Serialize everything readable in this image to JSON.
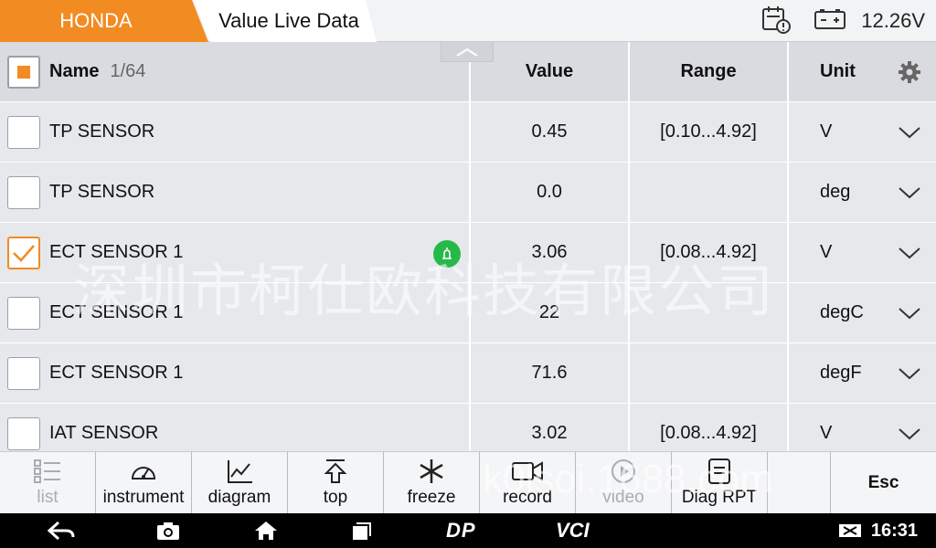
{
  "header": {
    "make_tab": "HONDA",
    "screen_tab": "Value Live Data",
    "voltage": "12.26V"
  },
  "columns": {
    "name": "Name",
    "count": "1/64",
    "value": "Value",
    "range": "Range",
    "unit": "Unit"
  },
  "rows": [
    {
      "name": "TP SENSOR",
      "value": "0.45",
      "range": "[0.10...4.92]",
      "unit": "V",
      "checked": false,
      "alert": false
    },
    {
      "name": "TP SENSOR",
      "value": "0.0",
      "range": "",
      "unit": "deg",
      "checked": false,
      "alert": false
    },
    {
      "name": "ECT SENSOR 1",
      "value": "3.06",
      "range": "[0.08...4.92]",
      "unit": "V",
      "checked": true,
      "alert": true
    },
    {
      "name": "ECT SENSOR 1",
      "value": "22",
      "range": "",
      "unit": "degC",
      "checked": false,
      "alert": false
    },
    {
      "name": "ECT SENSOR 1",
      "value": "71.6",
      "range": "",
      "unit": "degF",
      "checked": false,
      "alert": false
    },
    {
      "name": "IAT SENSOR",
      "value": "3.02",
      "range": "[0.08...4.92]",
      "unit": "V",
      "checked": false,
      "alert": false
    }
  ],
  "toolbar": {
    "list": "list",
    "instrument": "instrument",
    "diagram": "diagram",
    "top": "top",
    "freeze": "freeze",
    "record": "record",
    "video": "video",
    "diag_rpt": "Diag RPT",
    "esc": "Esc"
  },
  "navbar": {
    "dp": "DP",
    "vci": "VCI",
    "clock": "16:31"
  },
  "watermark": {
    "cn": "深圳市柯仕欧科技有限公司",
    "url": "k0lsoi.1688.com"
  },
  "colors": {
    "accent": "#f28b22",
    "alert": "#27b84a",
    "row_bg": "#e6e8ec"
  }
}
